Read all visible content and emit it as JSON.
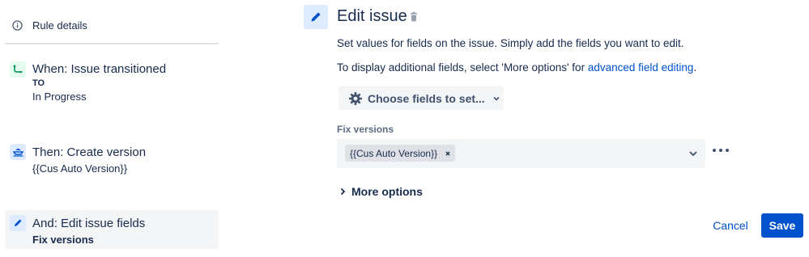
{
  "sidebar": {
    "rule_details_label": "Rule details",
    "trigger": {
      "icon": "issue-transition-icon",
      "title": "When: Issue transitioned",
      "to_label": "TO",
      "status": "In Progress"
    },
    "actions": [
      {
        "icon": "ship-icon",
        "title": "Then: Create version",
        "detail": "{{Cus Auto Version}}"
      },
      {
        "icon": "pencil-icon",
        "title": "And: Edit issue fields",
        "detail": "Fix versions"
      }
    ]
  },
  "editor": {
    "title": "Edit issue",
    "description": "Set values for fields on the issue. Simply add the fields you want to edit.",
    "additional_prefix": "To display additional fields, select 'More options' for ",
    "additional_link": "advanced field editing",
    "additional_suffix": ".",
    "choose_fields_label": "Choose fields to set...",
    "field": {
      "label": "Fix versions",
      "tags": [
        "{{Cus Auto Version}}"
      ]
    },
    "more_options_label": "More options",
    "cancel_label": "Cancel",
    "save_label": "Save"
  },
  "colors": {
    "accent": "#0052cc",
    "trigger_bg": "#e3fcef",
    "action_bg": "#deebff",
    "selected_bg": "#f4f5f7"
  }
}
